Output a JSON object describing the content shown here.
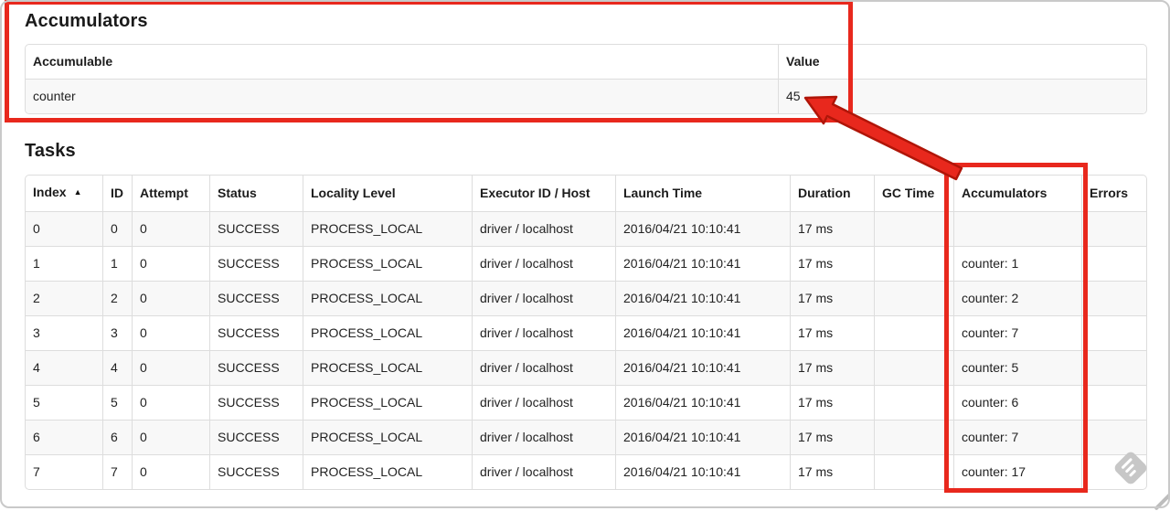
{
  "accumulators_section": {
    "title": "Accumulators",
    "table": {
      "headers": [
        "Accumulable",
        "Value"
      ],
      "rows": [
        {
          "accumulable": "counter",
          "value": "45"
        }
      ]
    }
  },
  "tasks_section": {
    "title": "Tasks",
    "table": {
      "headers": [
        "Index",
        "ID",
        "Attempt",
        "Status",
        "Locality Level",
        "Executor ID / Host",
        "Launch Time",
        "Duration",
        "GC Time",
        "Accumulators",
        "Errors"
      ],
      "sort_icon": "▲",
      "sorted_column": "Index",
      "sort_direction": "ascending",
      "rows": [
        {
          "index": "0",
          "id": "0",
          "attempt": "0",
          "status": "SUCCESS",
          "locality": "PROCESS_LOCAL",
          "executor": "driver / localhost",
          "launch": "2016/04/21 10:10:41",
          "duration": "17 ms",
          "gc": "",
          "accumulators": "",
          "errors": ""
        },
        {
          "index": "1",
          "id": "1",
          "attempt": "0",
          "status": "SUCCESS",
          "locality": "PROCESS_LOCAL",
          "executor": "driver / localhost",
          "launch": "2016/04/21 10:10:41",
          "duration": "17 ms",
          "gc": "",
          "accumulators": "counter: 1",
          "errors": ""
        },
        {
          "index": "2",
          "id": "2",
          "attempt": "0",
          "status": "SUCCESS",
          "locality": "PROCESS_LOCAL",
          "executor": "driver / localhost",
          "launch": "2016/04/21 10:10:41",
          "duration": "17 ms",
          "gc": "",
          "accumulators": "counter: 2",
          "errors": ""
        },
        {
          "index": "3",
          "id": "3",
          "attempt": "0",
          "status": "SUCCESS",
          "locality": "PROCESS_LOCAL",
          "executor": "driver / localhost",
          "launch": "2016/04/21 10:10:41",
          "duration": "17 ms",
          "gc": "",
          "accumulators": "counter: 7",
          "errors": ""
        },
        {
          "index": "4",
          "id": "4",
          "attempt": "0",
          "status": "SUCCESS",
          "locality": "PROCESS_LOCAL",
          "executor": "driver / localhost",
          "launch": "2016/04/21 10:10:41",
          "duration": "17 ms",
          "gc": "",
          "accumulators": "counter: 5",
          "errors": ""
        },
        {
          "index": "5",
          "id": "5",
          "attempt": "0",
          "status": "SUCCESS",
          "locality": "PROCESS_LOCAL",
          "executor": "driver / localhost",
          "launch": "2016/04/21 10:10:41",
          "duration": "17 ms",
          "gc": "",
          "accumulators": "counter: 6",
          "errors": ""
        },
        {
          "index": "6",
          "id": "6",
          "attempt": "0",
          "status": "SUCCESS",
          "locality": "PROCESS_LOCAL",
          "executor": "driver / localhost",
          "launch": "2016/04/21 10:10:41",
          "duration": "17 ms",
          "gc": "",
          "accumulators": "counter: 7",
          "errors": ""
        },
        {
          "index": "7",
          "id": "7",
          "attempt": "0",
          "status": "SUCCESS",
          "locality": "PROCESS_LOCAL",
          "executor": "driver / localhost",
          "launch": "2016/04/21 10:10:41",
          "duration": "17 ms",
          "gc": "",
          "accumulators": "counter: 17",
          "errors": ""
        }
      ]
    }
  },
  "annotations": {
    "color": "#e8281d",
    "arrow_outline_color": "#b01508"
  },
  "watermark": {
    "icon": "skitch-pen-watermark"
  }
}
